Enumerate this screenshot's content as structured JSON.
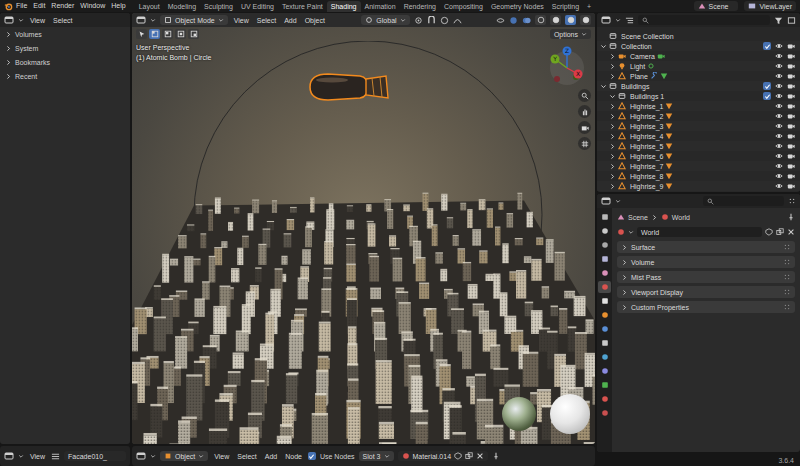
{
  "menu": {
    "items": [
      "File",
      "Edit",
      "Render",
      "Window",
      "Help"
    ]
  },
  "workspaces": [
    {
      "label": "Layout",
      "selected": false
    },
    {
      "label": "Modeling",
      "selected": false
    },
    {
      "label": "Sculpting",
      "selected": false
    },
    {
      "label": "UV Editing",
      "selected": false
    },
    {
      "label": "Texture Paint",
      "selected": false
    },
    {
      "label": "Shading",
      "selected": true
    },
    {
      "label": "Animation",
      "selected": false
    },
    {
      "label": "Rendering",
      "selected": false
    },
    {
      "label": "Compositing",
      "selected": false
    },
    {
      "label": "Geometry Nodes",
      "selected": false
    },
    {
      "label": "Scripting",
      "selected": false
    }
  ],
  "add_workspace": "+",
  "scene": "Scene",
  "view_layer": "ViewLayer",
  "file_browser": {
    "menus": [
      "View",
      "Select"
    ],
    "sections": [
      {
        "label": "Volumes",
        "expanded": false
      },
      {
        "label": "System",
        "expanded": false
      },
      {
        "label": "Bookmarks",
        "expanded": false
      },
      {
        "label": "Recent",
        "expanded": false
      }
    ],
    "footer": {
      "menu": "View",
      "path": "Facade010_"
    }
  },
  "viewport": {
    "mode": "Object Mode",
    "menus": [
      "View",
      "Select",
      "Add",
      "Object"
    ],
    "orientation": "Global",
    "select_modes": [
      {
        "selected": true
      },
      {
        "selected": false
      },
      {
        "selected": false
      },
      {
        "selected": false
      }
    ],
    "shading": [
      {
        "selected": false
      },
      {
        "selected": false
      },
      {
        "selected": true
      },
      {
        "selected": false
      }
    ],
    "options": "Options",
    "overlay": [
      "User Perspective",
      "(1) Atomic Bomb | Circle"
    ],
    "gizmo": [
      {
        "label": "Z",
        "color": "#2f72d6"
      },
      {
        "label": "Y",
        "color": "#6fa51f"
      },
      {
        "label": "X",
        "color": "#db3a47"
      }
    ]
  },
  "node_editor": {
    "mode": "Object",
    "menus": [
      "View",
      "Select",
      "Add",
      "Node"
    ],
    "use_nodes": {
      "label": "Use Nodes",
      "checked": true
    },
    "slot": "Slot 3",
    "material": "Material.014"
  },
  "outliner": {
    "rows": [
      {
        "label": "Scene Collection",
        "depth": 0,
        "kind": "scene"
      },
      {
        "label": "Collection",
        "depth": 0,
        "kind": "collection",
        "expanded": true,
        "checked": true,
        "visible": true,
        "renderable": true
      },
      {
        "label": "Camera",
        "depth": 1,
        "kind": "camera",
        "expanded": false,
        "visible": true,
        "renderable": true
      },
      {
        "label": "Light",
        "depth": 1,
        "kind": "light",
        "expanded": false,
        "visible": true,
        "renderable": true
      },
      {
        "label": "Plane",
        "depth": 1,
        "kind": "mesh",
        "expanded": false,
        "modifier": true,
        "color": "#4fb24f",
        "visible": true,
        "renderable": true
      },
      {
        "label": "Buildings",
        "depth": 0,
        "kind": "collection",
        "expanded": true,
        "checked": true,
        "visible": true,
        "renderable": true
      },
      {
        "label": "Buildings 1",
        "depth": 1,
        "kind": "collection",
        "expanded": true,
        "checked": true,
        "visible": true,
        "renderable": true
      },
      {
        "label": "Highrise_1",
        "depth": 1,
        "kind": "mesh",
        "expanded": false,
        "modifier": false,
        "color": "#e8902f",
        "visible": true,
        "renderable": true
      },
      {
        "label": "Highrise_2",
        "depth": 1,
        "kind": "mesh",
        "expanded": false,
        "modifier": false,
        "color": "#e8902f",
        "visible": true,
        "renderable": true
      },
      {
        "label": "Highrise_3",
        "depth": 1,
        "kind": "mesh",
        "expanded": false,
        "modifier": false,
        "color": "#e8902f",
        "visible": true,
        "renderable": true
      },
      {
        "label": "Highrise_4",
        "depth": 1,
        "kind": "mesh",
        "expanded": false,
        "modifier": false,
        "color": "#e8902f",
        "visible": true,
        "renderable": true
      },
      {
        "label": "Highrise_5",
        "depth": 1,
        "kind": "mesh",
        "expanded": false,
        "modifier": false,
        "color": "#e8902f",
        "visible": true,
        "renderable": true
      },
      {
        "label": "Highrise_6",
        "depth": 1,
        "kind": "mesh",
        "expanded": false,
        "modifier": false,
        "color": "#e8902f",
        "visible": true,
        "renderable": true
      },
      {
        "label": "Highrise_7",
        "depth": 1,
        "kind": "mesh",
        "expanded": false,
        "modifier": false,
        "color": "#e8902f",
        "visible": true,
        "renderable": true
      },
      {
        "label": "Highrise_8",
        "depth": 1,
        "kind": "mesh",
        "expanded": false,
        "modifier": false,
        "color": "#e8902f",
        "visible": true,
        "renderable": true
      },
      {
        "label": "Highrise_9",
        "depth": 1,
        "kind": "mesh",
        "expanded": false,
        "modifier": false,
        "color": "#e8902f",
        "visible": true,
        "renderable": true
      }
    ]
  },
  "properties": {
    "tabs": [
      {
        "color": "#b8b8b8",
        "selected": false
      },
      {
        "color": "#c9c9c9",
        "selected": false
      },
      {
        "color": "#a9a9a9",
        "selected": false
      },
      {
        "color": "#b5b5d8",
        "selected": false
      },
      {
        "color": "#d98fb8",
        "selected": false
      },
      {
        "color": "#d9534f",
        "selected": true
      },
      {
        "color": "#e0e0e0",
        "selected": false
      },
      {
        "color": "#e8902f",
        "selected": false
      },
      {
        "color": "#5a8fd6",
        "selected": false
      },
      {
        "color": "#c9c9c9",
        "selected": false
      },
      {
        "color": "#4fa3d1",
        "selected": false
      },
      {
        "color": "#8a8ae0",
        "selected": false
      },
      {
        "color": "#4fb24f",
        "selected": false
      },
      {
        "color": "#d9534f",
        "selected": false
      },
      {
        "color": "#c84f4f",
        "selected": false
      }
    ],
    "breadcrumb": [
      "Scene",
      "World"
    ],
    "world": "World",
    "panels": [
      {
        "label": "Surface",
        "expanded": false
      },
      {
        "label": "Volume",
        "expanded": false
      },
      {
        "label": "Mist Pass",
        "expanded": false
      },
      {
        "label": "Viewport Display",
        "expanded": false
      },
      {
        "label": "Custom Properties",
        "expanded": false
      }
    ]
  },
  "status": {
    "version": "3.6.4"
  }
}
